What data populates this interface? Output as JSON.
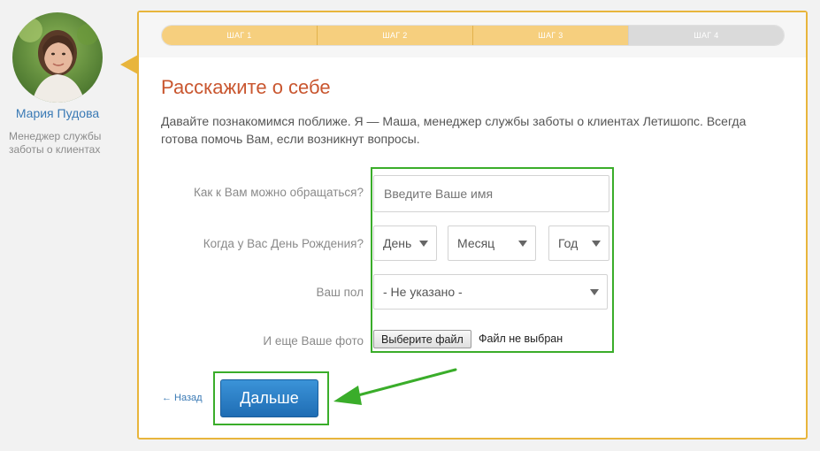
{
  "manager": {
    "name": "Мария Пудова",
    "role": "Менеджер службы заботы о клиентах"
  },
  "steps": [
    {
      "label": "ШАГ 1",
      "done": true
    },
    {
      "label": "ШАГ 2",
      "done": true
    },
    {
      "label": "ШАГ 3",
      "done": true
    },
    {
      "label": "ШАГ 4",
      "done": false
    }
  ],
  "title": "Расскажите о себе",
  "intro": "Давайте познакомимся поближе. Я — Маша, менеджер службы заботы о клиентах Летишопс. Всегда готова помочь Вам, если возникнут вопросы.",
  "form": {
    "name_label": "Как к Вам можно обращаться?",
    "name_placeholder": "Введите Ваше имя",
    "birthday_label": "Когда у Вас День Рождения?",
    "day_value": "День",
    "month_value": "Месяц",
    "year_value": "Год",
    "gender_label": "Ваш пол",
    "gender_value": "- Не указано -",
    "photo_label": "И еще Ваше фото",
    "file_button": "Выберите файл",
    "file_status": "Файл не выбран"
  },
  "nav": {
    "back_label": "← Назад",
    "next_label": "Дальше"
  },
  "colors": {
    "accent_border": "#e8b53c",
    "title": "#c9562f",
    "highlight": "#3aad2a",
    "button": "#2a7fc6"
  }
}
